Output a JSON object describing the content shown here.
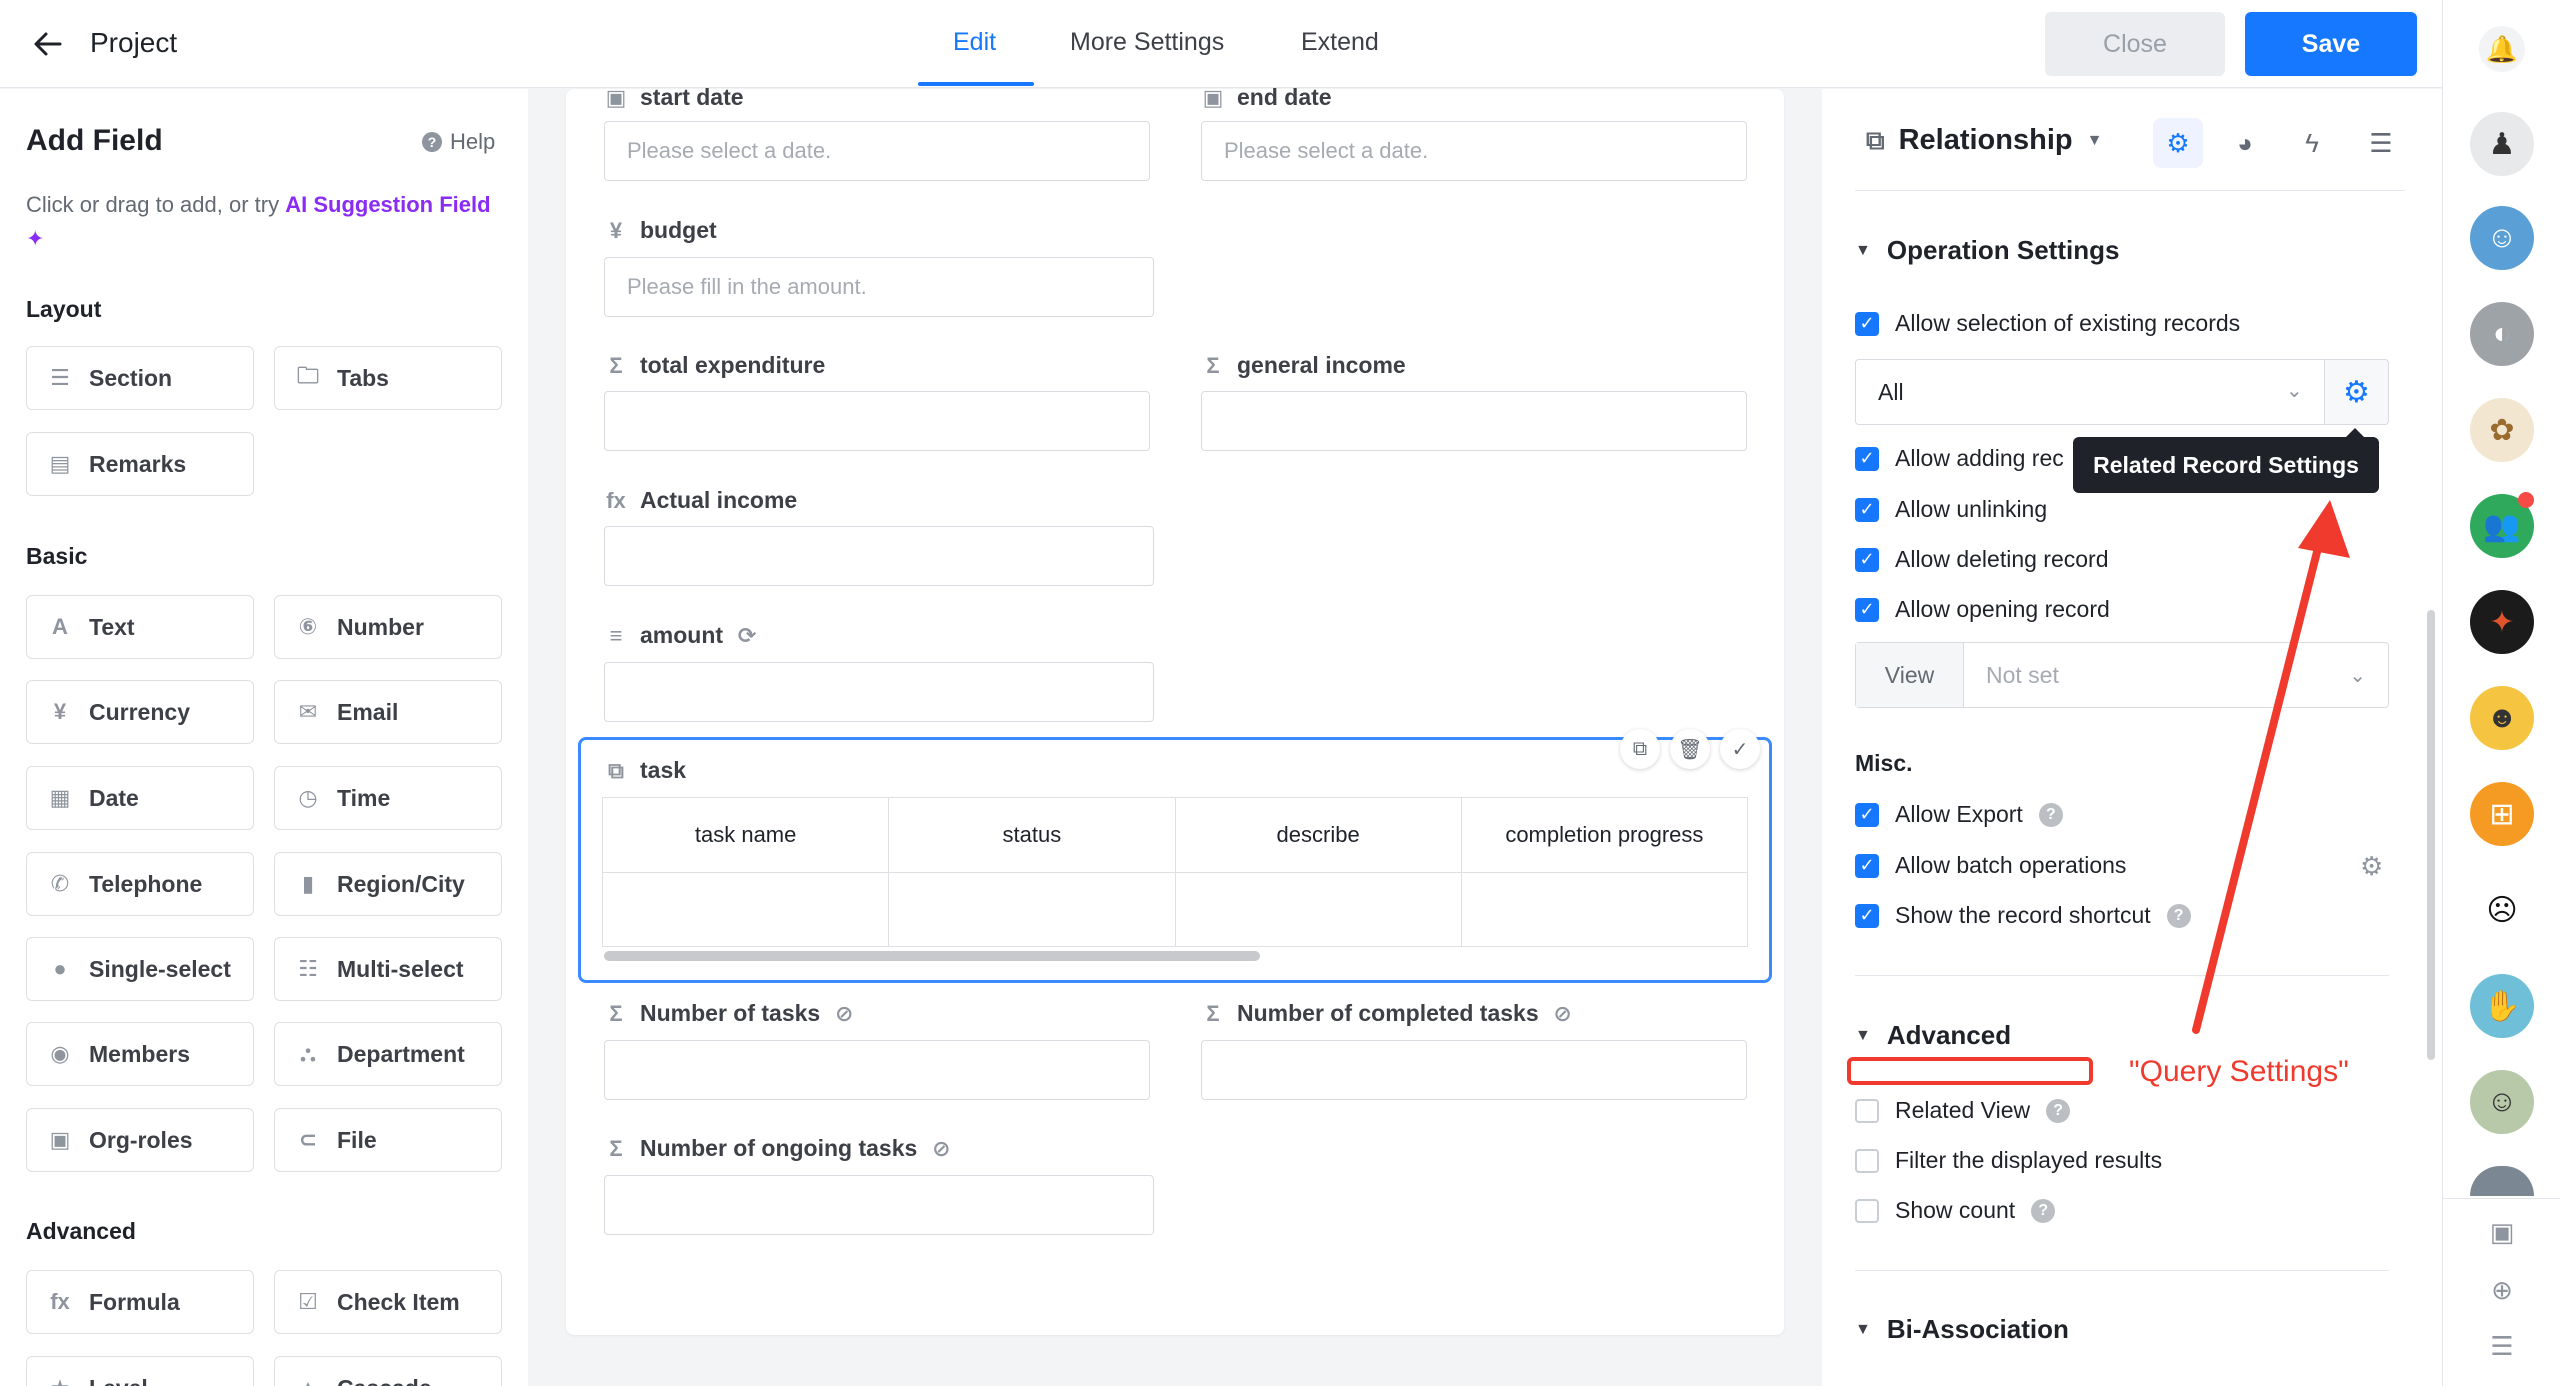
{
  "topbar": {
    "title": "Project",
    "tabs": [
      {
        "label": "Edit",
        "active": true
      },
      {
        "label": "More Settings"
      },
      {
        "label": "Extend"
      }
    ],
    "close_label": "Close",
    "save_label": "Save"
  },
  "left": {
    "title": "Add Field",
    "help": "Help",
    "hint_prefix": "Click or drag to add, or try ",
    "hint_ai": "AI Suggestion Field ✦",
    "groups": {
      "layout": {
        "title": "Layout",
        "items": [
          "Section",
          "Tabs",
          "Remarks"
        ]
      },
      "basic": {
        "title": "Basic",
        "items": [
          "Text",
          "Number",
          "Currency",
          "Email",
          "Date",
          "Time",
          "Telephone",
          "Region/City",
          "Single-select",
          "Multi-select",
          "Members",
          "Department",
          "Org-roles",
          "File"
        ]
      },
      "advanced": {
        "title": "Advanced",
        "items": [
          "Formula",
          "Check Item",
          "Level",
          "Cascade"
        ]
      }
    }
  },
  "form": {
    "start_date": {
      "label": "start date",
      "placeholder": "Please select a date."
    },
    "end_date": {
      "label": "end date",
      "placeholder": "Please select a date."
    },
    "budget": {
      "label": "budget",
      "placeholder": "Please fill in the amount."
    },
    "total_expenditure": {
      "label": "total expenditure"
    },
    "general_income": {
      "label": "general income"
    },
    "actual_income": {
      "label": "Actual income"
    },
    "amount": {
      "label": "amount"
    },
    "task": {
      "label": "task",
      "columns": [
        "task name",
        "status",
        "describe",
        "completion progress"
      ]
    },
    "num_tasks": {
      "label": "Number of tasks"
    },
    "num_completed": {
      "label": "Number of completed tasks"
    },
    "num_ongoing": {
      "label": "Number of ongoing tasks"
    }
  },
  "right": {
    "title": "Relationship",
    "operation": {
      "title": "Operation Settings",
      "allow_select": "Allow selection of existing records",
      "scope_value": "All",
      "allow_adding": "Allow adding rec",
      "tooltip": "Related Record Settings",
      "allow_unlinking": "Allow unlinking",
      "allow_deleting": "Allow deleting record",
      "allow_opening": "Allow opening record",
      "view_label": "View",
      "view_value": "Not set"
    },
    "misc": {
      "title": "Misc.",
      "allow_export": "Allow Export",
      "allow_batch": "Allow batch operations",
      "show_shortcut": "Show the record shortcut"
    },
    "advanced": {
      "title": "Advanced",
      "related_view": "Related View",
      "filter_results": "Filter the displayed results",
      "show_count": "Show count"
    },
    "bi": {
      "title": "Bi-Association"
    },
    "annotation": "\"Query Settings\""
  },
  "colors": {
    "primary": "#1677ff",
    "annotation": "#f03a2e",
    "ai": "#8b2cf5"
  }
}
